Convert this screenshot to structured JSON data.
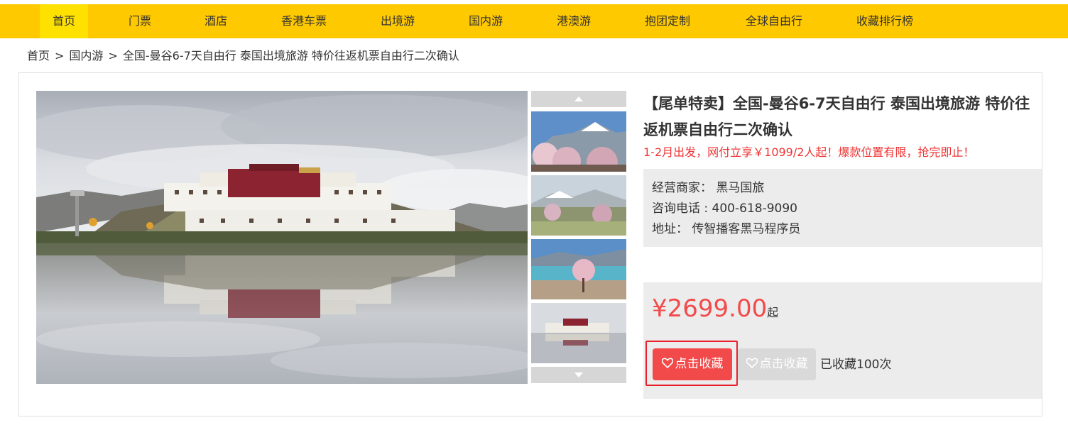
{
  "nav": {
    "items": [
      {
        "label": "首页",
        "active": true
      },
      {
        "label": "门票"
      },
      {
        "label": "酒店"
      },
      {
        "label": "香港车票"
      },
      {
        "label": "出境游"
      },
      {
        "label": "国内游"
      },
      {
        "label": "港澳游"
      },
      {
        "label": "抱团定制"
      },
      {
        "label": "全球自由行"
      },
      {
        "label": "收藏排行榜"
      }
    ]
  },
  "breadcrumb": {
    "home": "首页",
    "category": "国内游",
    "current": "全国-曼谷6-7天自由行 泰国出境旅游 特价往返机票自由行二次确认",
    "sep": ">"
  },
  "product": {
    "title": "【尾单特卖】全国-曼谷6-7天自由行 泰国出境旅游 特价往返机票自由行二次确认",
    "promo": "1-2月出发，网付立享￥1099/2人起！爆款位置有限，抢完即止！",
    "merchant_label": "经营商家：",
    "merchant_value": "黑马国旅",
    "phone_label": "咨询电话 :",
    "phone_value": "400-618-9090",
    "address_label": "地址：",
    "address_value": "传智播客黑马程序员",
    "price": "¥2699.00",
    "price_suffix": "起",
    "fav_button": "点击收藏",
    "fav_button_disabled": "点击收藏",
    "fav_count": "已收藏100次"
  },
  "colors": {
    "nav_bg": "#ffc900",
    "nav_active": "#ffe100",
    "price": "#f24a4a",
    "promo": "#ee3333",
    "highlight_border": "#e8222a"
  },
  "icons": {
    "heart": "heart-icon",
    "thumb_up": "arrow-up-icon",
    "thumb_down": "arrow-down-icon"
  }
}
